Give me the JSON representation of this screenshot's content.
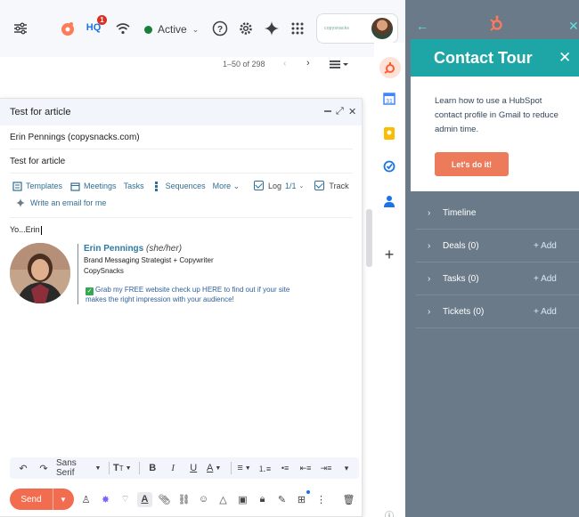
{
  "topbar": {
    "status": "Active",
    "hq_badge": "1",
    "hq_text": "HQ",
    "brand_text": "copysnacks"
  },
  "pager": {
    "text": "1–50 of 298"
  },
  "compose": {
    "title": "Test for article",
    "to": "Erin Pennings (copysnacks.com)",
    "subject": "Test for article",
    "tools": {
      "templates": "Templates",
      "meetings": "Meetings",
      "tasks": "Tasks",
      "sequences": "Sequences",
      "more": "More",
      "log": "Log",
      "log_count": "1/1",
      "track": "Track",
      "write_ai": "Write an email for me"
    },
    "body": "Yo...Erin",
    "signature": {
      "name": "Erin Pennings",
      "pronouns": "(she/her)",
      "role": "Brand Messaging Strategist + Copywriter",
      "company": "CopySnacks",
      "cta": "Grab my FREE website check up HERE to find out if your site makes the right impression with your audience!"
    },
    "format": {
      "font": "Sans Serif"
    },
    "send": "Send"
  },
  "hubspot": {
    "tour_title": "Contact Tour",
    "tour_text": "Learn how to use a HubSpot contact profile in Gmail to reduce admin time.",
    "tour_button": "Let's do it!",
    "sections": [
      {
        "label": "Timeline",
        "add": ""
      },
      {
        "label": "Deals (0)",
        "add": "+ Add"
      },
      {
        "label": "Tasks (0)",
        "add": "+ Add"
      },
      {
        "label": "Tickets (0)",
        "add": "+ Add"
      }
    ]
  },
  "colors": {
    "hubspot_orange": "#f26d4f",
    "teal": "#1ea6a6",
    "panel_gray": "#6b7a88",
    "link_blue": "#2f6f96"
  }
}
